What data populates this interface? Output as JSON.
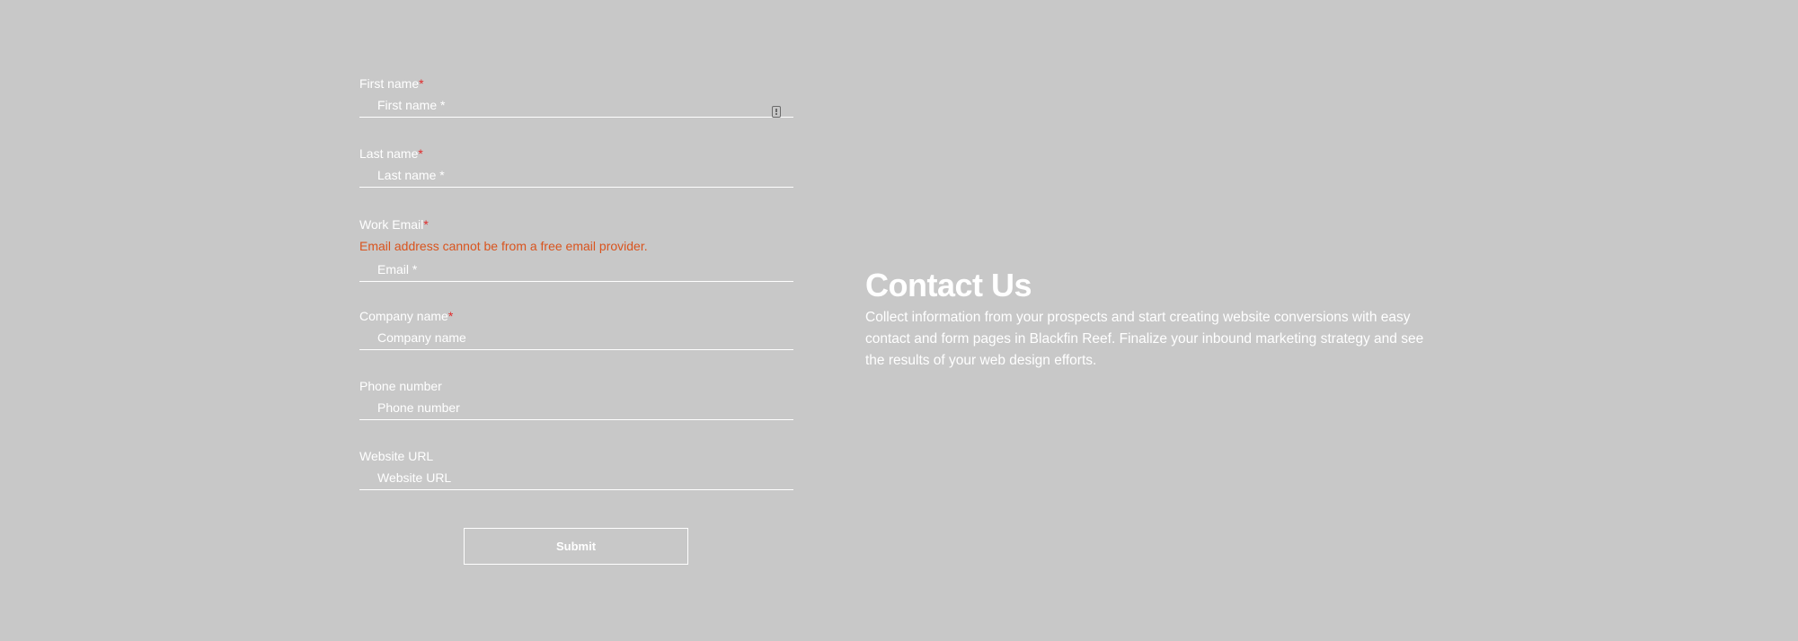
{
  "form": {
    "first_name": {
      "label": "First name",
      "required_mark": "*",
      "placeholder": "First name *",
      "value": ""
    },
    "last_name": {
      "label": "Last name",
      "required_mark": "*",
      "placeholder": "Last name *",
      "value": ""
    },
    "work_email": {
      "label": "Work Email",
      "required_mark": "*",
      "error": "Email address cannot be from a free email provider.",
      "placeholder": "Email *",
      "value": ""
    },
    "company_name": {
      "label": "Company name",
      "required_mark": "*",
      "placeholder": "Company name",
      "value": ""
    },
    "phone_number": {
      "label": "Phone number",
      "placeholder": "Phone number",
      "value": ""
    },
    "website_url": {
      "label": "Website URL",
      "placeholder": "Website URL",
      "value": ""
    },
    "submit_label": "Submit"
  },
  "info": {
    "title": "Contact Us",
    "description": "Collect information from your prospects and start creating website conversions with easy contact and form pages in Blackfin Reef. Finalize your inbound marketing strategy and see the results of your web design efforts."
  },
  "colors": {
    "background": "#c8c8c8",
    "text": "#ffffff",
    "required_asterisk": "#e02b2b",
    "error": "#d9541e"
  },
  "icons": {
    "autofill": "contact-card-icon"
  }
}
